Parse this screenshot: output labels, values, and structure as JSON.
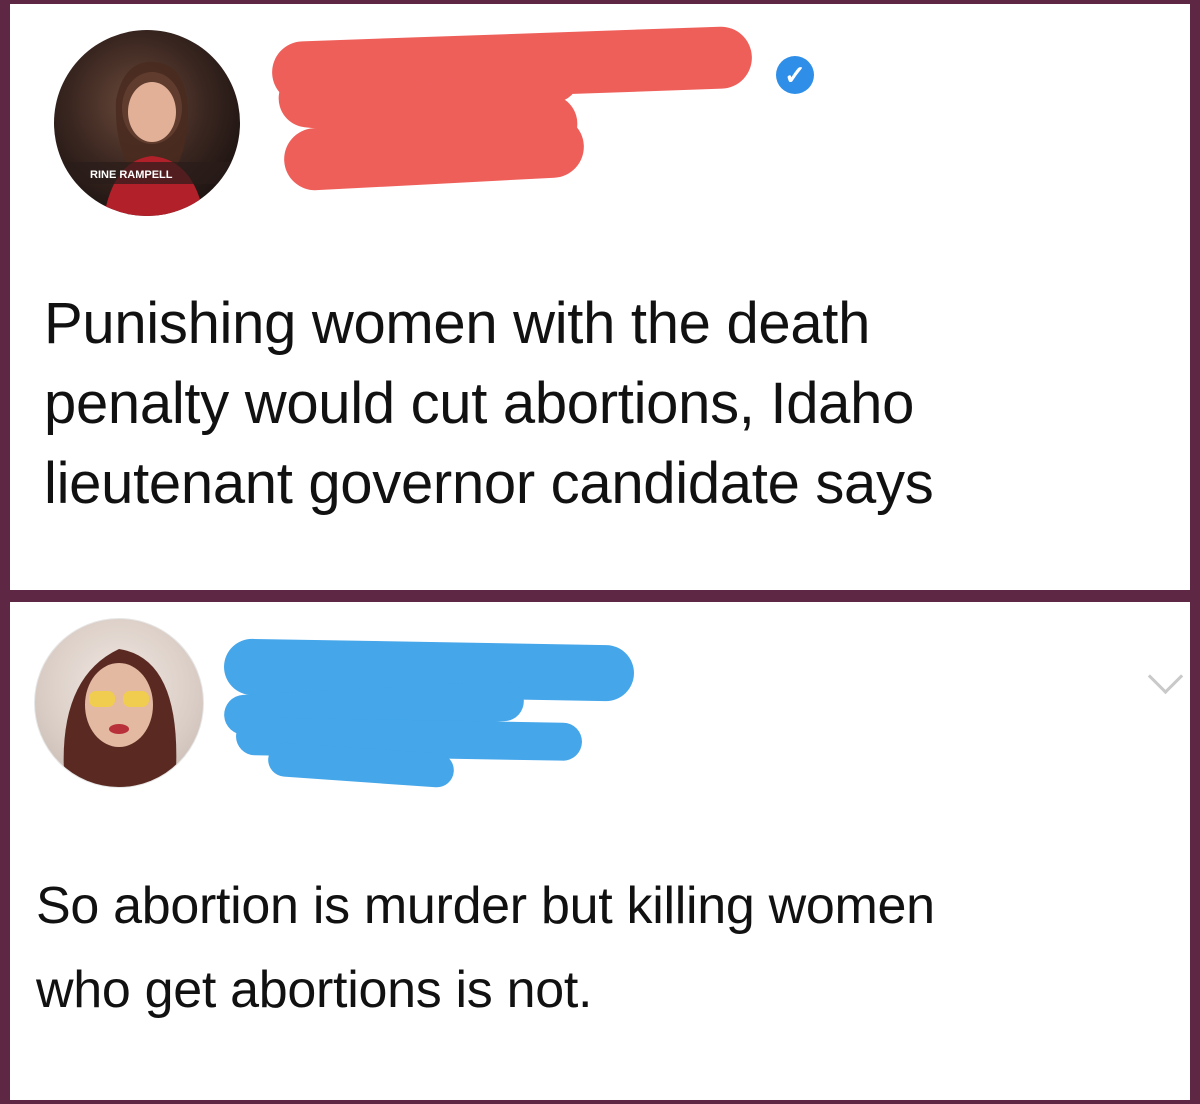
{
  "tweet_1": {
    "avatar_caption": "RINE RAMPELL",
    "text": "Punishing women with the death\npenalty would cut abortions, Idaho\nlieutenant governor candidate says"
  },
  "tweet_2": {
    "text": "So abortion is murder but killing women\nwho get abortions is not."
  },
  "colors": {
    "frame": "#5e2845",
    "redact_top": "#ef5f5a",
    "redact_bottom": "#45a6ea",
    "verified": "#2f8fe8"
  },
  "icons": {
    "verified_badge": "✓"
  }
}
